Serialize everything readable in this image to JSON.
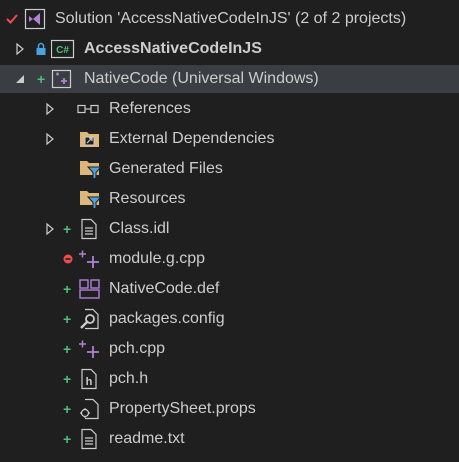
{
  "colors": {
    "background": "#1f1f1f",
    "text": "#cccccc",
    "selected_row": "#3a3d41",
    "vs_purple": "#b180d7",
    "added_green": "#4ec07a",
    "removed_red": "#f14c4c",
    "folder_yellow": "#dcb67a",
    "filter_blue": "#4aa3df"
  },
  "solution": {
    "label": "Solution 'AccessNativeCodeInJS' (2 of 2 projects)",
    "status_icon": "check-icon"
  },
  "projects": [
    {
      "label": "AccessNativeCodeInJS",
      "icon": "csharp-project-icon",
      "badge": "lock-icon",
      "expanded": false
    },
    {
      "label": "NativeCode (Universal Windows)",
      "icon": "cpp-project-icon",
      "status": "+",
      "expanded": true
    }
  ],
  "items": [
    {
      "label": "References",
      "icon": "references-icon",
      "status": ""
    },
    {
      "label": "External Dependencies",
      "icon": "external-dependencies-icon",
      "status": ""
    },
    {
      "label": "Generated Files",
      "icon": "filter-folder-icon",
      "status": ""
    },
    {
      "label": "Resources",
      "icon": "filter-folder-icon",
      "status": ""
    },
    {
      "label": "Class.idl",
      "icon": "file-icon",
      "status": "+"
    },
    {
      "label": "module.g.cpp",
      "icon": "cpp-file-icon",
      "status": "−"
    },
    {
      "label": "NativeCode.def",
      "icon": "def-file-icon",
      "status": "+"
    },
    {
      "label": "packages.config",
      "icon": "config-file-icon",
      "status": "+"
    },
    {
      "label": "pch.cpp",
      "icon": "cpp-file-icon",
      "status": "+"
    },
    {
      "label": "pch.h",
      "icon": "header-file-icon",
      "status": "+"
    },
    {
      "label": "PropertySheet.props",
      "icon": "props-file-icon",
      "status": "+"
    },
    {
      "label": "readme.txt",
      "icon": "text-file-icon",
      "status": "+"
    }
  ]
}
